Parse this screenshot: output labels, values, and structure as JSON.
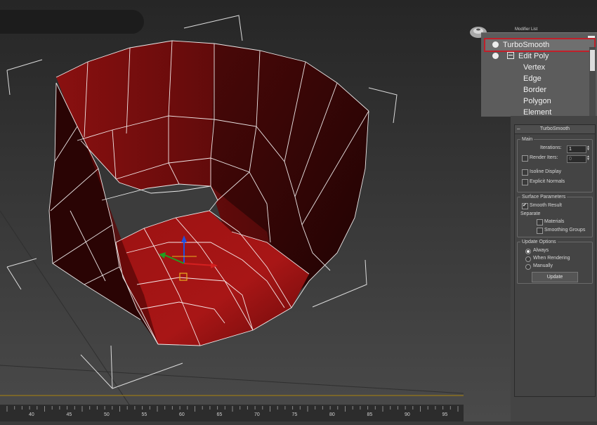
{
  "viewport": {
    "background_top": "#2b2b2b",
    "background_bottom": "#474747",
    "mesh_color": "#a01414",
    "mesh_dark": "#2a0505",
    "edge_color": "#ffffff",
    "gizmo": {
      "x_color": "#d42020",
      "y_color": "#20a020",
      "z_color": "#2050e0",
      "pivot_color": "#e8b020"
    }
  },
  "modifier_stack": {
    "header_label": "Modifier List",
    "items": [
      {
        "label": "TurboSmooth",
        "selected": true,
        "icon": "lightbulb-icon"
      },
      {
        "label": "Edit Poly",
        "selected": false,
        "icon": "lightbulb-icon",
        "expand": "collapse-box-icon"
      }
    ],
    "sub_objects": [
      "Vertex",
      "Edge",
      "Border",
      "Polygon",
      "Element"
    ],
    "accent_color": "#c0202a"
  },
  "turbosmooth": {
    "rollout_title": "TurboSmooth",
    "collapse_glyph": "–",
    "main": {
      "title": "Main",
      "iterations_label": "Iterations:",
      "iterations_value": "1",
      "render_iters_label": "Render Iters:",
      "render_iters_value": "0",
      "render_iters_checked": false,
      "isoline_label": "Isoline Display",
      "isoline_checked": false,
      "explicit_normals_label": "Explicit Normals",
      "explicit_normals_checked": false
    },
    "surface": {
      "title": "Surface Parameters",
      "smooth_result_label": "Smooth Result",
      "smooth_result_checked": true,
      "separate_label": "Separate",
      "materials_label": "Materials",
      "materials_checked": false,
      "smoothing_groups_label": "Smoothing Groups",
      "smoothing_groups_checked": false
    },
    "update": {
      "title": "Update Options",
      "options": [
        "Always",
        "When Rendering",
        "Manually"
      ],
      "selected": "Always",
      "button_label": "Update"
    }
  },
  "timeline_ruler": {
    "labels": [
      "40",
      "45",
      "50",
      "55",
      "60",
      "65",
      "70",
      "75",
      "80",
      "85",
      "90",
      "95"
    ]
  }
}
